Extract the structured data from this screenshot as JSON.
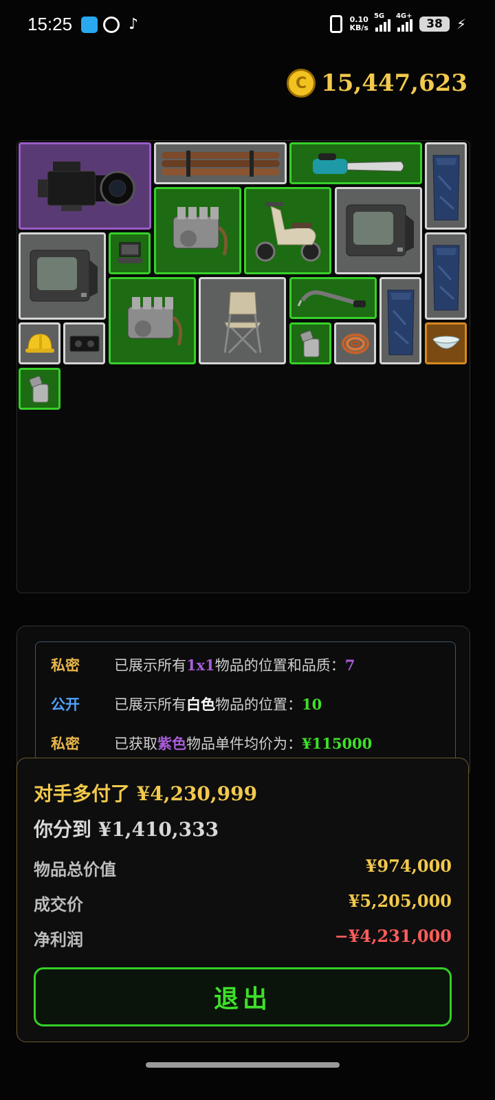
{
  "status_bar": {
    "time": "15:25",
    "net_speed_value": "0.10",
    "net_speed_unit": "KB/s",
    "signal1_label": "5G",
    "signal2_label": "4G+",
    "battery": "38"
  },
  "wallet": {
    "coins": "15,447,623"
  },
  "items": [
    {
      "name": "cinema-camera",
      "quality": "purple"
    },
    {
      "name": "metal-pipes",
      "quality": "gray"
    },
    {
      "name": "chainsaw",
      "quality": "green"
    },
    {
      "name": "blue-bag",
      "quality": "gray"
    },
    {
      "name": "engine",
      "quality": "green"
    },
    {
      "name": "scooter",
      "quality": "green"
    },
    {
      "name": "crt-tv",
      "quality": "gray"
    },
    {
      "name": "crt-tv",
      "quality": "gray"
    },
    {
      "name": "laptop",
      "quality": "green"
    },
    {
      "name": "blue-bag",
      "quality": "gray"
    },
    {
      "name": "engine",
      "quality": "green"
    },
    {
      "name": "folding-chair",
      "quality": "gray"
    },
    {
      "name": "welding-torch",
      "quality": "green"
    },
    {
      "name": "blue-bag",
      "quality": "gray"
    },
    {
      "name": "hard-hat",
      "quality": "gray"
    },
    {
      "name": "vhs-tape",
      "quality": "gray"
    },
    {
      "name": "zippo-lighter",
      "quality": "green"
    },
    {
      "name": "copper-wire",
      "quality": "gray"
    },
    {
      "name": "porcelain-bowl",
      "quality": "gold"
    },
    {
      "name": "zippo-lighter",
      "quality": "green"
    }
  ],
  "info": {
    "rows": [
      {
        "tag": "私密",
        "pre": "已展示所有",
        "hl": "1x1",
        "post": "物品的位置和品质：",
        "value": "7"
      },
      {
        "tag": "公开",
        "pre": "已展示所有",
        "hl": "白色",
        "post": "物品的位置：",
        "value": "10"
      },
      {
        "tag": "私密",
        "pre": "已获取",
        "hl": "紫色",
        "post": "物品单件均价为：",
        "value": "¥115000"
      }
    ]
  },
  "result": {
    "overpaid": "对手多付了 ¥4,230,999",
    "your_share": "你分到 ¥1,410,333",
    "total_value_label": "物品总价值",
    "total_value": "¥974,000",
    "deal_price_label": "成交价",
    "deal_price": "¥5,205,000",
    "net_profit_label": "净利润",
    "net_profit": "−¥4,231,000",
    "exit_label": "退出"
  },
  "colors": {
    "purple_quality": "#9b5cc7",
    "green_quality": "#37d12a",
    "gray_quality": "#d6d6d6",
    "gold_quality": "#d68a1e",
    "gold_text": "#f2c94c",
    "loss_text": "#ff5d5d"
  }
}
